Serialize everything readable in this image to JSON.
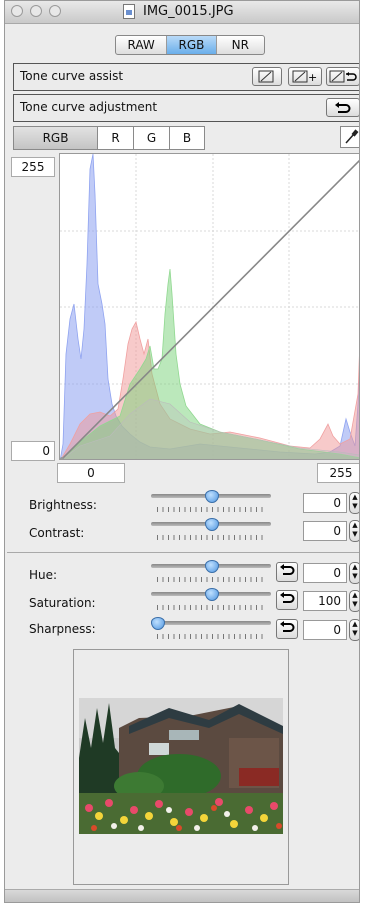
{
  "window": {
    "title": "IMG_0015.JPG"
  },
  "mode_tabs": [
    {
      "label": "RAW"
    },
    {
      "label": "RGB"
    },
    {
      "label": "NR"
    }
  ],
  "tone_curve_assist": {
    "label": "Tone curve assist"
  },
  "tone_curve_adjustment": {
    "label": "Tone curve adjustment"
  },
  "channel_tabs": [
    {
      "label": "RGB"
    },
    {
      "label": "R"
    },
    {
      "label": "G"
    },
    {
      "label": "B"
    }
  ],
  "graph": {
    "y_max": "255",
    "y_min": "0",
    "x_min": "0",
    "x_max": "255"
  },
  "sliders": {
    "brightness": {
      "label": "Brightness:",
      "value": "0"
    },
    "contrast": {
      "label": "Contrast:",
      "value": "0"
    },
    "hue": {
      "label": "Hue:",
      "value": "0"
    },
    "saturation": {
      "label": "Saturation:",
      "value": "100"
    },
    "sharpness": {
      "label": "Sharpness:",
      "value": "0"
    }
  },
  "colors": {
    "accent": "#6aaeea",
    "histogram_blue": "#8fa3f0",
    "histogram_red": "#f0a0a0",
    "histogram_green": "#90d890"
  }
}
